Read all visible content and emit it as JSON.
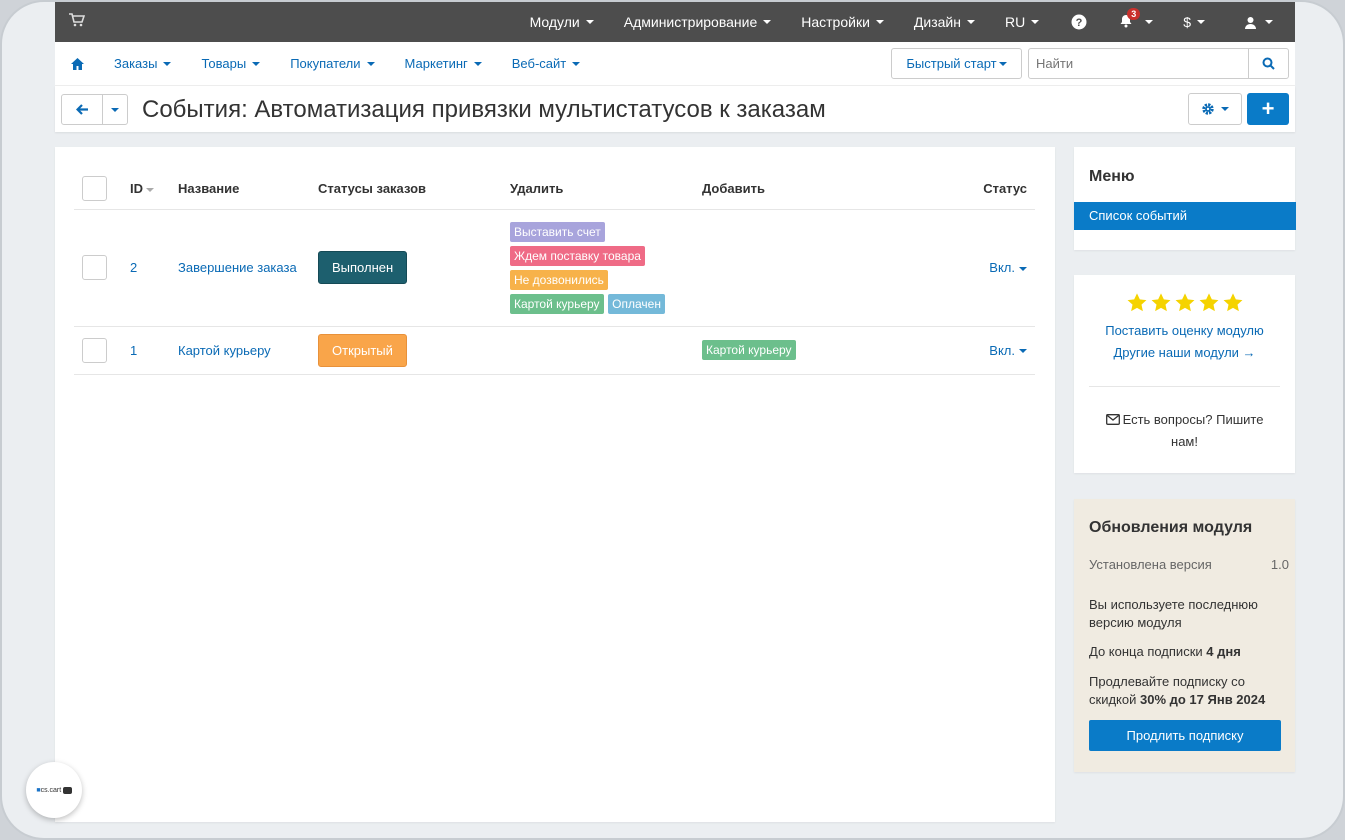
{
  "topbar": {
    "items": [
      {
        "label": "Модули",
        "caret": true
      },
      {
        "label": "Администрирование",
        "caret": true
      },
      {
        "label": "Настройки",
        "caret": true
      },
      {
        "label": "Дизайн",
        "caret": true
      },
      {
        "label": "RU",
        "caret": true
      }
    ],
    "notification_count": "3",
    "currency": "$"
  },
  "mainnav": {
    "items": [
      "Заказы",
      "Товары",
      "Покупатели",
      "Маркетинг",
      "Веб-сайт"
    ],
    "quick_start": "Быстрый старт",
    "search_placeholder": "Найти"
  },
  "page": {
    "title": "События: Автоматизация привязки мультистатусов к заказам"
  },
  "table": {
    "headers": {
      "id": "ID",
      "name": "Название",
      "order_statuses": "Статусы заказов",
      "remove": "Удалить",
      "add": "Добавить",
      "status": "Статус"
    },
    "rows": [
      {
        "id": "2",
        "name": "Завершение заказа",
        "order_status": "Выполнен",
        "remove_tags": [
          "Выставить счет",
          "Ждем поставку товара",
          "Не дозвонились",
          "Картой курьеру",
          "Оплачен"
        ],
        "add_tags": [],
        "status": "Вкл."
      },
      {
        "id": "1",
        "name": "Картой курьеру",
        "order_status": "Открытый",
        "remove_tags": [],
        "add_tags": [
          "Картой курьеру"
        ],
        "status": "Вкл."
      }
    ]
  },
  "sidebar": {
    "menu_title": "Меню",
    "menu_item": "Список событий",
    "rate_link": "Поставить оценку модулю",
    "other_link": "Другие наши модули →",
    "question": "Есть вопросы? Пишите нам!",
    "update": {
      "title": "Обновления модуля",
      "installed_label": "Установлена версия",
      "installed_value": "1.0",
      "latest_text": "Вы используете последнюю версию модуля",
      "subscription_prefix": "До конца подписки ",
      "subscription_days": "4 дня",
      "renew_text_prefix": "Продлевайте подписку со скидкой ",
      "renew_text_bold": "30% до 17 Янв 2024",
      "renew_button": "Продлить подписку"
    }
  },
  "logo": {
    "text": "cs.cart"
  },
  "colors": {
    "accent": "#0a7bc8",
    "status_completed": "#1d5f6e",
    "status_open": "#f9a54a",
    "tag_invoice": "#a8a4dc",
    "tag_waiting": "#ef6b86",
    "tag_noanswer": "#f7b24a",
    "tag_courier": "#6cbf8c",
    "tag_paid": "#74b9d9"
  }
}
